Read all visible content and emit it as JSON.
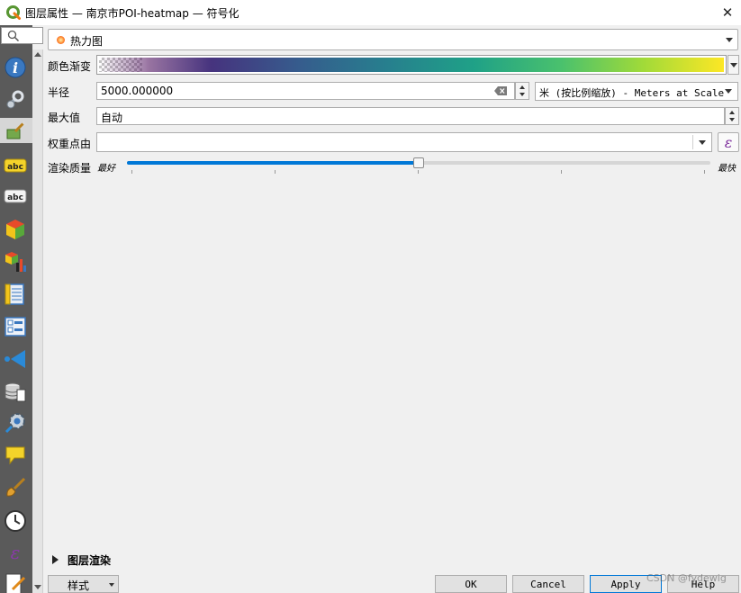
{
  "window": {
    "title": "图层属性 — 南京市POI-heatmap — 符号化",
    "close_glyph": "✕"
  },
  "sidebar": {
    "search_placeholder": "",
    "items": [
      {
        "name": "information-icon"
      },
      {
        "name": "source-icon"
      },
      {
        "name": "symbology-icon",
        "active": true
      },
      {
        "name": "labels-icon"
      },
      {
        "name": "masks-icon"
      },
      {
        "name": "3d-view-icon"
      },
      {
        "name": "diagrams-icon"
      },
      {
        "name": "fields-icon"
      },
      {
        "name": "attributes-form-icon"
      },
      {
        "name": "joins-icon"
      },
      {
        "name": "auxiliary-storage-icon"
      },
      {
        "name": "actions-icon"
      },
      {
        "name": "display-icon"
      },
      {
        "name": "rendering-icon"
      },
      {
        "name": "temporal-icon"
      },
      {
        "name": "variables-icon"
      },
      {
        "name": "metadata-icon"
      }
    ],
    "labels_icon_text": "abc",
    "masks_icon_text": "abc",
    "variables_icon_text": "ε"
  },
  "renderer": {
    "selected": "热力图",
    "color": "#ff7a2a"
  },
  "color_ramp": {
    "label": "颜色渐变",
    "colors": [
      "#440154",
      "#46337e",
      "#365c8d",
      "#277f8e",
      "#1fa187",
      "#4ac16d",
      "#a0da39",
      "#fde725"
    ]
  },
  "radius": {
    "label": "半径",
    "value": "5000.000000",
    "unit": "米 (按比例缩放) - Meters at Scale"
  },
  "max_value": {
    "label": "最大值",
    "value": "自动"
  },
  "weight": {
    "label": "权重点由",
    "value": "",
    "expression_glyph": "ε"
  },
  "quality": {
    "label": "渲染质量",
    "min_label": "最好",
    "max_label": "最快",
    "value_fraction": 0.5
  },
  "layer_rendering": {
    "label": "图层渲染"
  },
  "buttons": {
    "style": "样式",
    "ok": "OK",
    "cancel": "Cancel",
    "apply": "Apply",
    "help": "Help"
  },
  "watermark": "CSDN @fydewig",
  "colors": {
    "accent": "#0078d7",
    "sidebar_bg": "#5a5a5a",
    "expression": "#7a2a9a"
  }
}
